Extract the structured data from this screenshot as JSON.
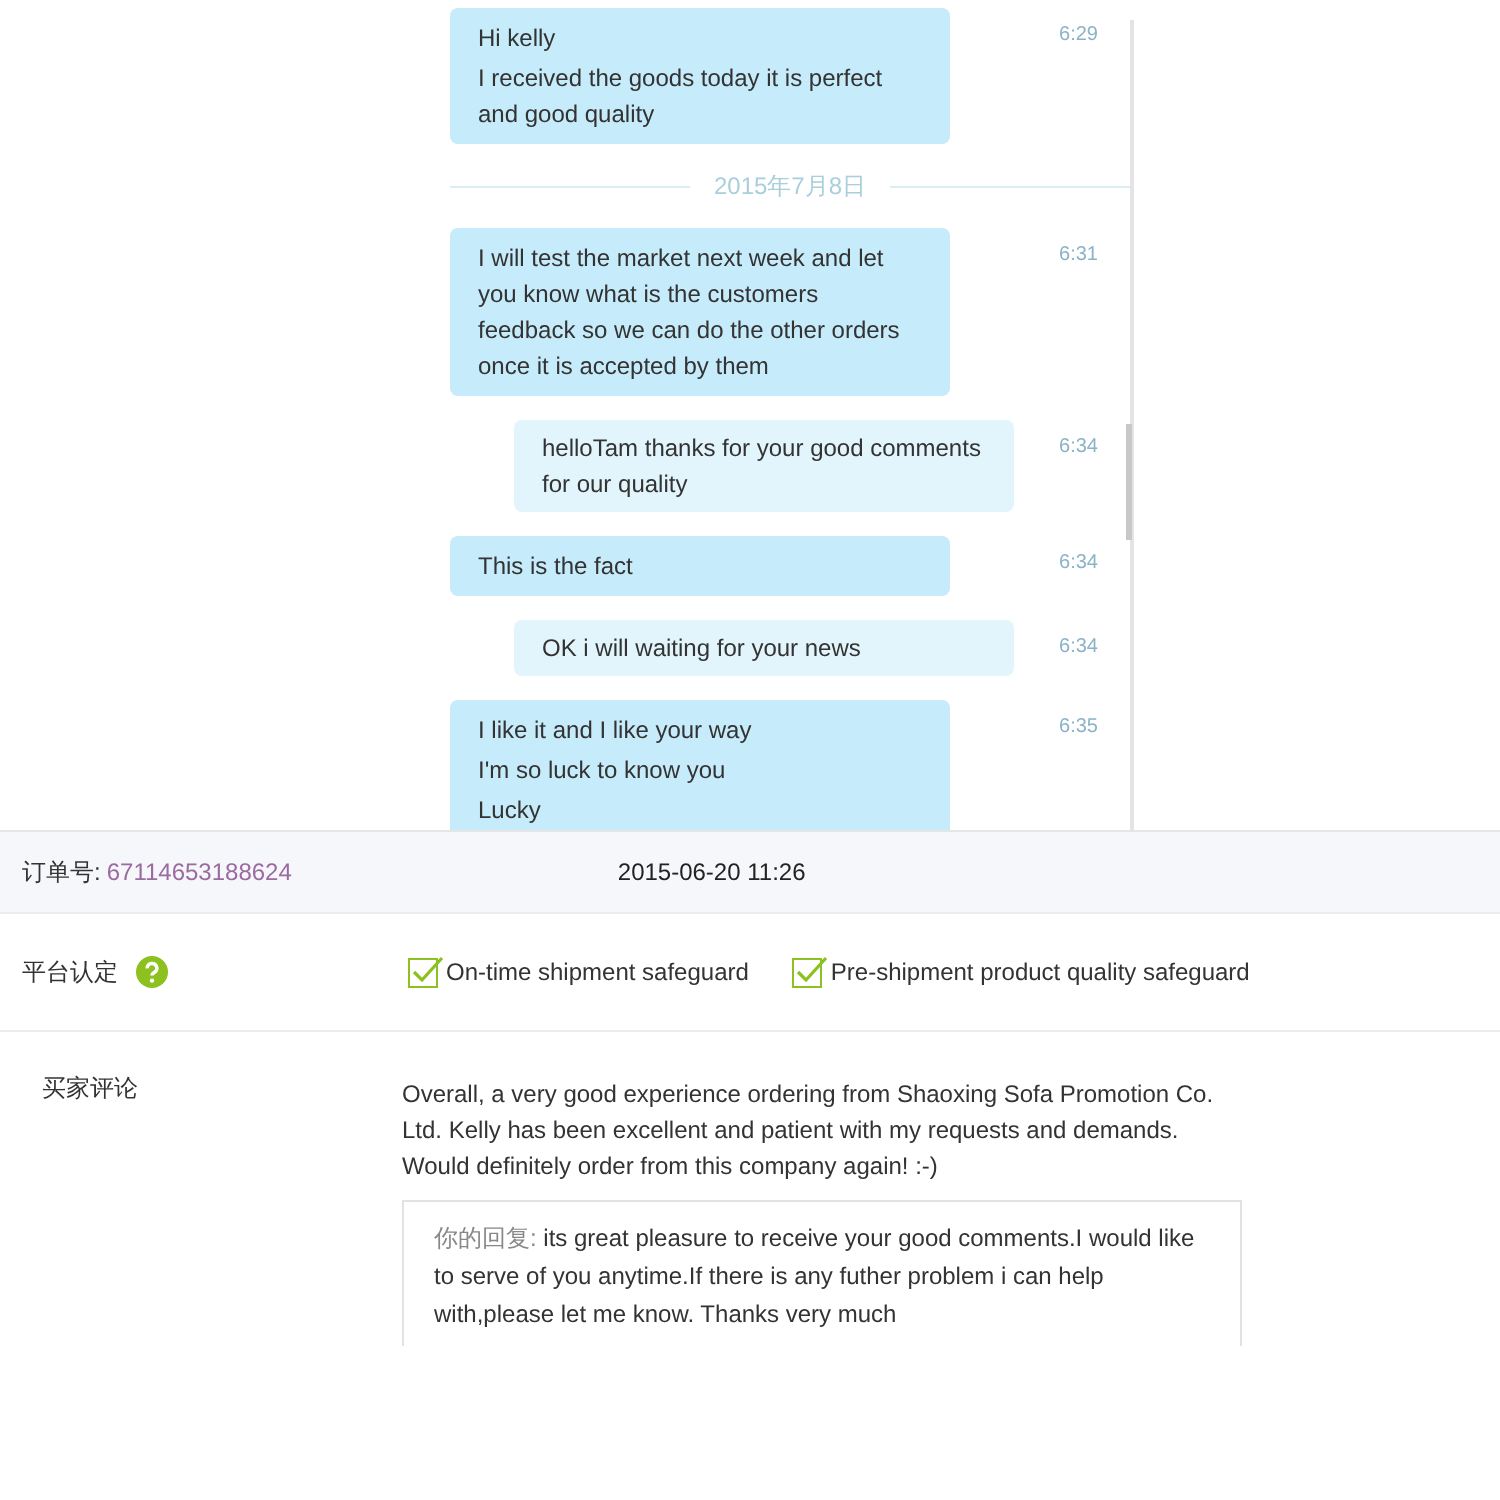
{
  "chat": {
    "messages": [
      {
        "kind": "sent",
        "lines": [
          "Hi kelly",
          "I received the goods today it is perfect and good quality"
        ],
        "time": "6:29"
      },
      {
        "kind": "divider",
        "text": "2015年7月8日"
      },
      {
        "kind": "sent",
        "lines": [
          "I will test the market next week and let you know what is the customers feedback so we can do the other orders once it is accepted by them"
        ],
        "time": "6:31"
      },
      {
        "kind": "received",
        "lines": [
          "helloTam thanks for your good comments for our quality"
        ],
        "time": "6:34"
      },
      {
        "kind": "sent",
        "lines": [
          "This is the fact"
        ],
        "time": "6:34"
      },
      {
        "kind": "received",
        "lines": [
          "OK i will waiting for your news"
        ],
        "time": "6:34"
      },
      {
        "kind": "sent",
        "lines": [
          "I like it and I like your way",
          "I'm so luck to know you",
          "Lucky"
        ],
        "time": "6:35"
      }
    ]
  },
  "order": {
    "label": "订单号:",
    "number": "67114653188624",
    "date": "2015-06-20 11:26"
  },
  "certification": {
    "label": "平台认定",
    "guarantees": [
      {
        "text": "On-time shipment safeguard",
        "checked": true
      },
      {
        "text": "Pre-shipment product quality safeguard",
        "checked": true
      }
    ]
  },
  "review": {
    "label": "买家评论",
    "text": "Overall, a very good experience ordering from Shaoxing Sofa Promotion Co. Ltd. Kelly has been excellent and patient with my requests and demands. Would definitely order from this company again! :-)",
    "reply_label": "你的回复:",
    "reply": "its great pleasure to receive your good comments.I would like to serve of you anytime.If there is any futher problem i can help with,please let me know. Thanks very much"
  }
}
